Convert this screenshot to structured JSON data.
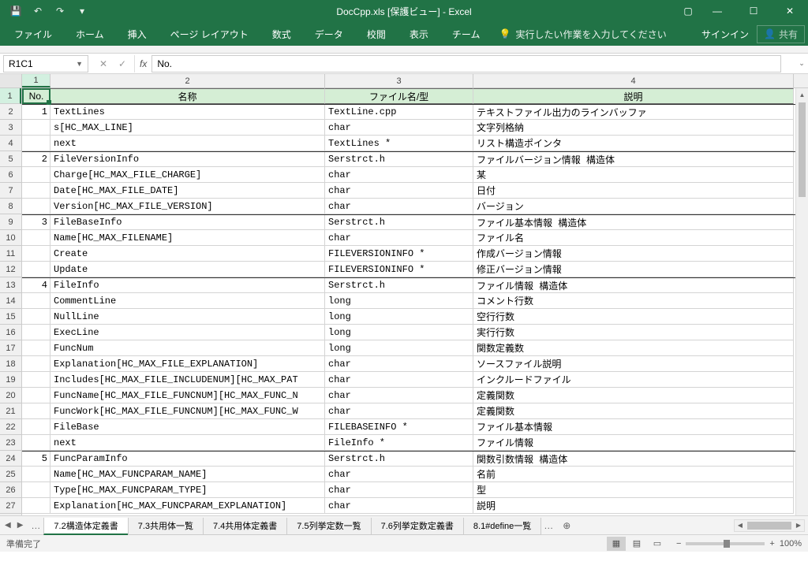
{
  "title": "DocCpp.xls [保護ビュー] - Excel",
  "qat": {
    "save": "💾",
    "undo": "↶",
    "redo": "↷",
    "custom": "▾"
  },
  "win": {
    "ribmin": "▢",
    "min": "—",
    "max": "☐",
    "close": "✕"
  },
  "ribbon": {
    "tabs": [
      "ファイル",
      "ホーム",
      "挿入",
      "ページ レイアウト",
      "数式",
      "データ",
      "校閲",
      "表示",
      "チーム"
    ],
    "tellme_icon": "💡",
    "tellme": "実行したい作業を入力してください",
    "signin": "サインイン",
    "share": "共有"
  },
  "namebox": "R1C1",
  "formula": "No.",
  "colHeaders": [
    "1",
    "2",
    "3",
    "4"
  ],
  "headerRow": {
    "no": "No.",
    "name": "名称",
    "file": "ファイル名/型",
    "desc": "説明"
  },
  "rows": [
    {
      "no": "1",
      "name": "TextLines",
      "file": "TextLine.cpp",
      "desc": "テキストファイル出力のラインバッファ",
      "sep": true
    },
    {
      "no": "",
      "name": "s[HC_MAX_LINE]",
      "file": "char",
      "desc": "文字列格納"
    },
    {
      "no": "",
      "name": "next",
      "file": "TextLines *",
      "desc": "リスト構造ポインタ"
    },
    {
      "no": "2",
      "name": "FileVersionInfo",
      "file": "Serstrct.h",
      "desc": "ファイルバージョン情報 構造体",
      "sep": true
    },
    {
      "no": "",
      "name": "Charge[HC_MAX_FILE_CHARGE]",
      "file": "char",
      "desc": "某"
    },
    {
      "no": "",
      "name": "Date[HC_MAX_FILE_DATE]",
      "file": "char",
      "desc": "日付"
    },
    {
      "no": "",
      "name": "Version[HC_MAX_FILE_VERSION]",
      "file": "char",
      "desc": "バージョン"
    },
    {
      "no": "3",
      "name": "FileBaseInfo",
      "file": "Serstrct.h",
      "desc": "ファイル基本情報 構造体",
      "sep": true
    },
    {
      "no": "",
      "name": "Name[HC_MAX_FILENAME]",
      "file": "char",
      "desc": "ファイル名"
    },
    {
      "no": "",
      "name": "Create",
      "file": "FILEVERSIONINFO *",
      "desc": "作成バージョン情報"
    },
    {
      "no": "",
      "name": "Update",
      "file": "FILEVERSIONINFO *",
      "desc": "修正バージョン情報"
    },
    {
      "no": "4",
      "name": "FileInfo",
      "file": "Serstrct.h",
      "desc": "ファイル情報 構造体",
      "sep": true
    },
    {
      "no": "",
      "name": "CommentLine",
      "file": "long",
      "desc": "コメント行数"
    },
    {
      "no": "",
      "name": "NullLine",
      "file": "long",
      "desc": "空行行数"
    },
    {
      "no": "",
      "name": "ExecLine",
      "file": "long",
      "desc": "実行行数"
    },
    {
      "no": "",
      "name": "FuncNum",
      "file": "long",
      "desc": "関数定義数"
    },
    {
      "no": "",
      "name": "Explanation[HC_MAX_FILE_EXPLANATION]",
      "file": "char",
      "desc": "ソースファイル説明"
    },
    {
      "no": "",
      "name": "Includes[HC_MAX_FILE_INCLUDENUM][HC_MAX_PAT",
      "file": "char",
      "desc": "インクルードファイル"
    },
    {
      "no": "",
      "name": "FuncName[HC_MAX_FILE_FUNCNUM][HC_MAX_FUNC_N",
      "file": "char",
      "desc": "定義関数"
    },
    {
      "no": "",
      "name": "FuncWork[HC_MAX_FILE_FUNCNUM][HC_MAX_FUNC_W",
      "file": "char",
      "desc": "定義関数"
    },
    {
      "no": "",
      "name": "FileBase",
      "file": "FILEBASEINFO *",
      "desc": "ファイル基本情報"
    },
    {
      "no": "",
      "name": "next",
      "file": "FileInfo *",
      "desc": "ファイル情報"
    },
    {
      "no": "5",
      "name": "FuncParamInfo",
      "file": "Serstrct.h",
      "desc": "関数引数情報 構造体",
      "sep": true
    },
    {
      "no": "",
      "name": "Name[HC_MAX_FUNCPARAM_NAME]",
      "file": "char",
      "desc": "名前"
    },
    {
      "no": "",
      "name": "Type[HC_MAX_FUNCPARAM_TYPE]",
      "file": "char",
      "desc": "型"
    },
    {
      "no": "",
      "name": "Explanation[HC_MAX_FUNCPARAM_EXPLANATION]",
      "file": "char",
      "desc": "説明"
    }
  ],
  "sheets": [
    "7.2構造体定義書",
    "7.3共用体一覧",
    "7.4共用体定義書",
    "7.5列挙定数一覧",
    "7.6列挙定数定義書",
    "8.1#define一覧"
  ],
  "activeSheet": 0,
  "status": "準備完了",
  "zoom": "100%"
}
